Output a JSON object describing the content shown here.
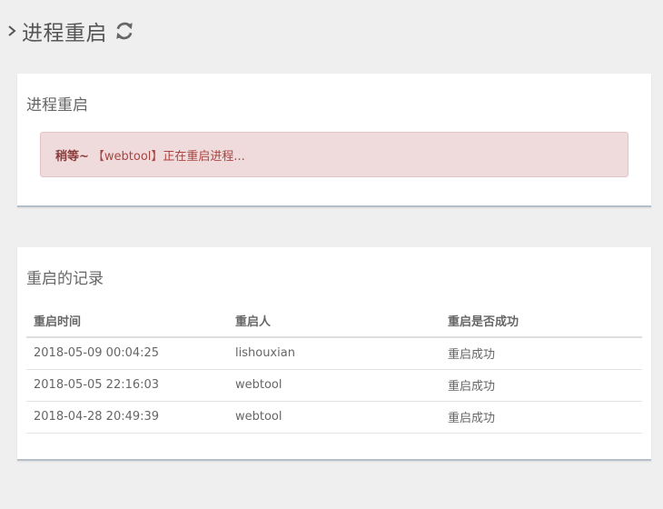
{
  "header": {
    "title": "进程重启",
    "chevron_icon": "chevron-right-icon",
    "refresh_icon": "refresh-icon"
  },
  "status_panel": {
    "title": "进程重启",
    "alert": {
      "strong": "稍等~",
      "message": "【webtool】正在重启进程..."
    }
  },
  "history_panel": {
    "title": "重启的记录",
    "columns": [
      "重启时间",
      "重启人",
      "重启是否成功"
    ],
    "rows": [
      [
        "2018-05-09 00:04:25",
        "lishouxian",
        "重启成功"
      ],
      [
        "2018-05-05 22:16:03",
        "webtool",
        "重启成功"
      ],
      [
        "2018-04-28 20:49:39",
        "webtool",
        "重启成功"
      ]
    ]
  },
  "colors": {
    "page_bg": "#efefef",
    "alert_bg": "#efdbdb",
    "alert_text": "#a94442",
    "panel_border": "#b4bfca"
  }
}
